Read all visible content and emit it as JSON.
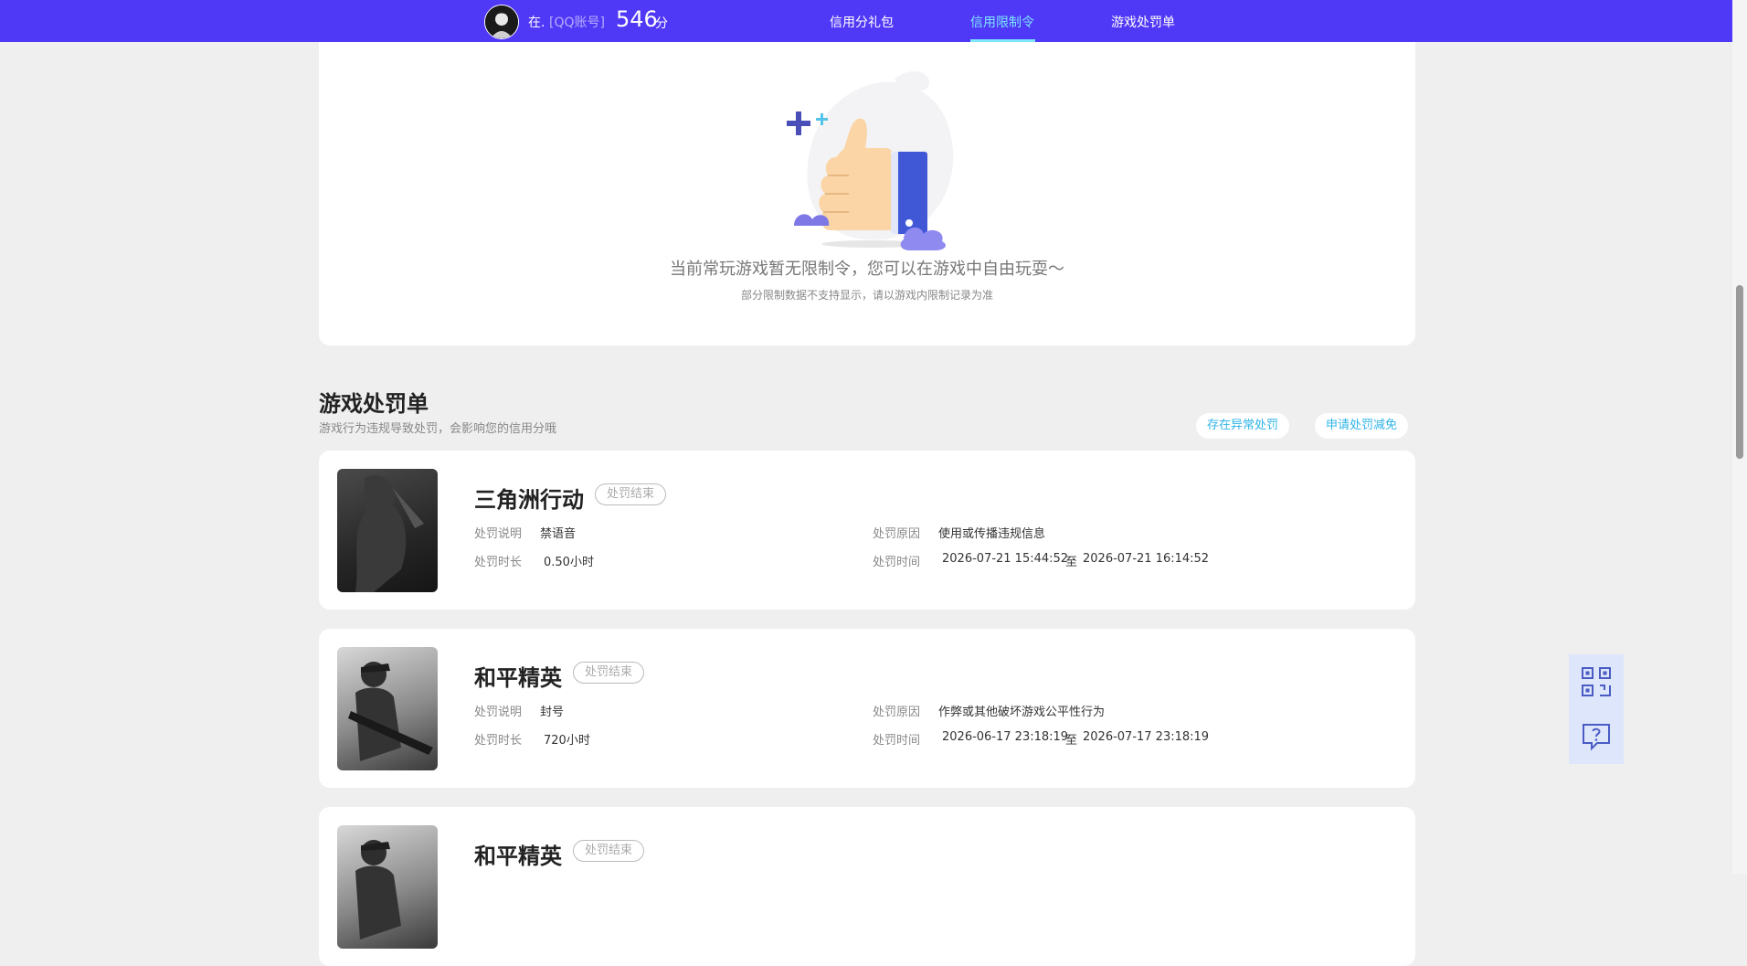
{
  "header": {
    "user_name": "在.",
    "account_type": "[QQ账号]",
    "credit_score": "546",
    "credit_unit": "分",
    "nav": [
      {
        "label": "信用分礼包"
      },
      {
        "label": "信用限制令"
      },
      {
        "label": "游戏处罚单"
      }
    ],
    "active_nav": "信用限制令",
    "accent_color": "#5038f7",
    "active_color": "#7ee6ff"
  },
  "restriction_empty": {
    "title": "当前常玩游戏暂无限制令，您可以在游戏中自由玩耍～",
    "subtitle": "部分限制数据不支持显示，请以游戏内限制记录为准",
    "illustration": "thumbs-up-icon"
  },
  "penalty_section": {
    "title": "游戏处罚单",
    "subtitle": "游戏行为违规导致处罚，会影响您的信用分哦",
    "actions": [
      {
        "label": "存在异常处罚"
      },
      {
        "label": "申请处罚减免"
      }
    ],
    "labels": {
      "desc": "处罚说明",
      "reason": "处罚原因",
      "duration": "处罚时长",
      "time": "处罚时间",
      "time_sep": "至"
    },
    "items": [
      {
        "game": "三角洲行动",
        "status": "处罚结束",
        "desc": "禁语音",
        "reason": "使用或传播违规信息",
        "duration": "0.50小时",
        "start": "2026-07-21 15:44:52",
        "end": "2026-07-21 16:14:52"
      },
      {
        "game": "和平精英",
        "status": "处罚结束",
        "desc": "封号",
        "reason": "作弊或其他破坏游戏公平性行为",
        "duration": "720小时",
        "start": "2026-06-17 23:18:19",
        "end": "2026-07-17 23:18:19"
      },
      {
        "game": "和平精英",
        "status": "处罚结束"
      }
    ]
  },
  "floating": [
    {
      "icon": "qr-code-icon"
    },
    {
      "icon": "help-chat-icon"
    }
  ]
}
